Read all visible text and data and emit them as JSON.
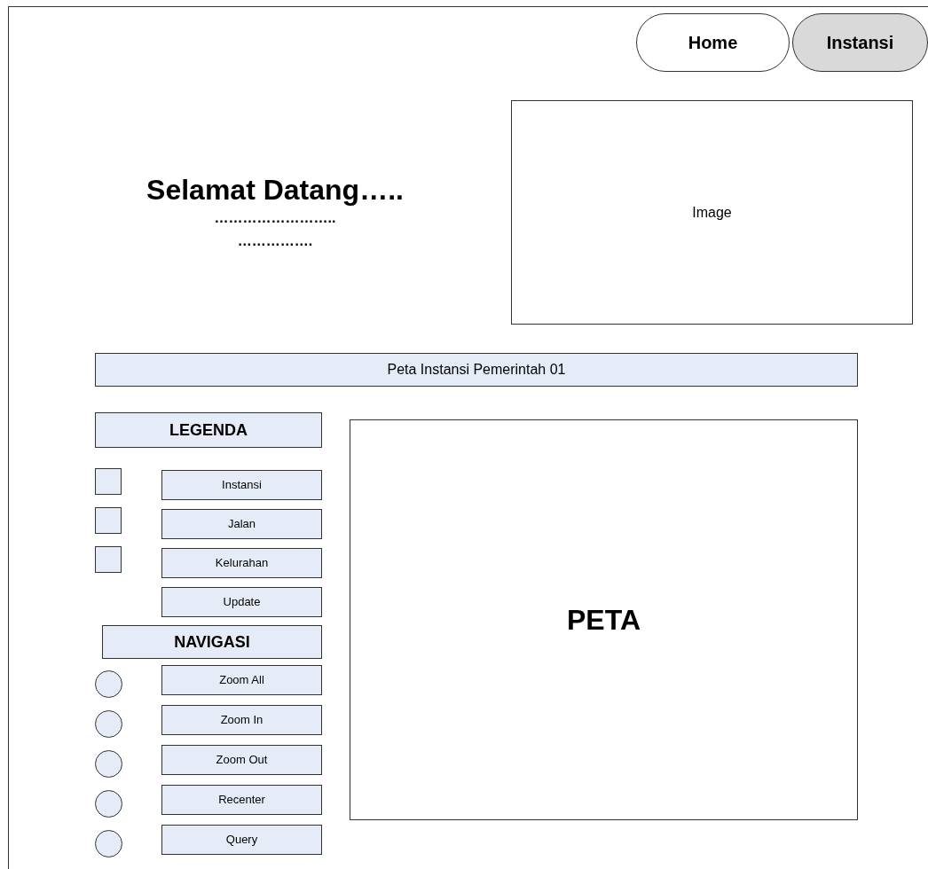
{
  "nav": [
    {
      "label": "Home",
      "selected": false
    },
    {
      "label": "Instansi",
      "selected": true
    }
  ],
  "welcome": {
    "title": "Selamat Datang…..",
    "lines": [
      "……………………..",
      "……………."
    ]
  },
  "image": {
    "label": "Image"
  },
  "map_title": "Peta Instansi Pemerintah 01",
  "legend": {
    "title": "LEGENDA",
    "items": [
      {
        "kind": "checkbox",
        "label": "Instansi",
        "checked": false
      },
      {
        "kind": "checkbox",
        "label": "Jalan",
        "checked": false
      },
      {
        "kind": "checkbox",
        "label": "Kelurahan",
        "checked": false
      },
      {
        "kind": "button",
        "label": "Update"
      }
    ]
  },
  "navigation": {
    "title": "NAVIGASI",
    "items": [
      {
        "label": "Zoom All",
        "selected": false
      },
      {
        "label": "Zoom In",
        "selected": false
      },
      {
        "label": "Zoom Out",
        "selected": false
      },
      {
        "label": "Recenter",
        "selected": false
      },
      {
        "label": "Query",
        "selected": false
      }
    ]
  },
  "map": {
    "label": "PETA"
  }
}
